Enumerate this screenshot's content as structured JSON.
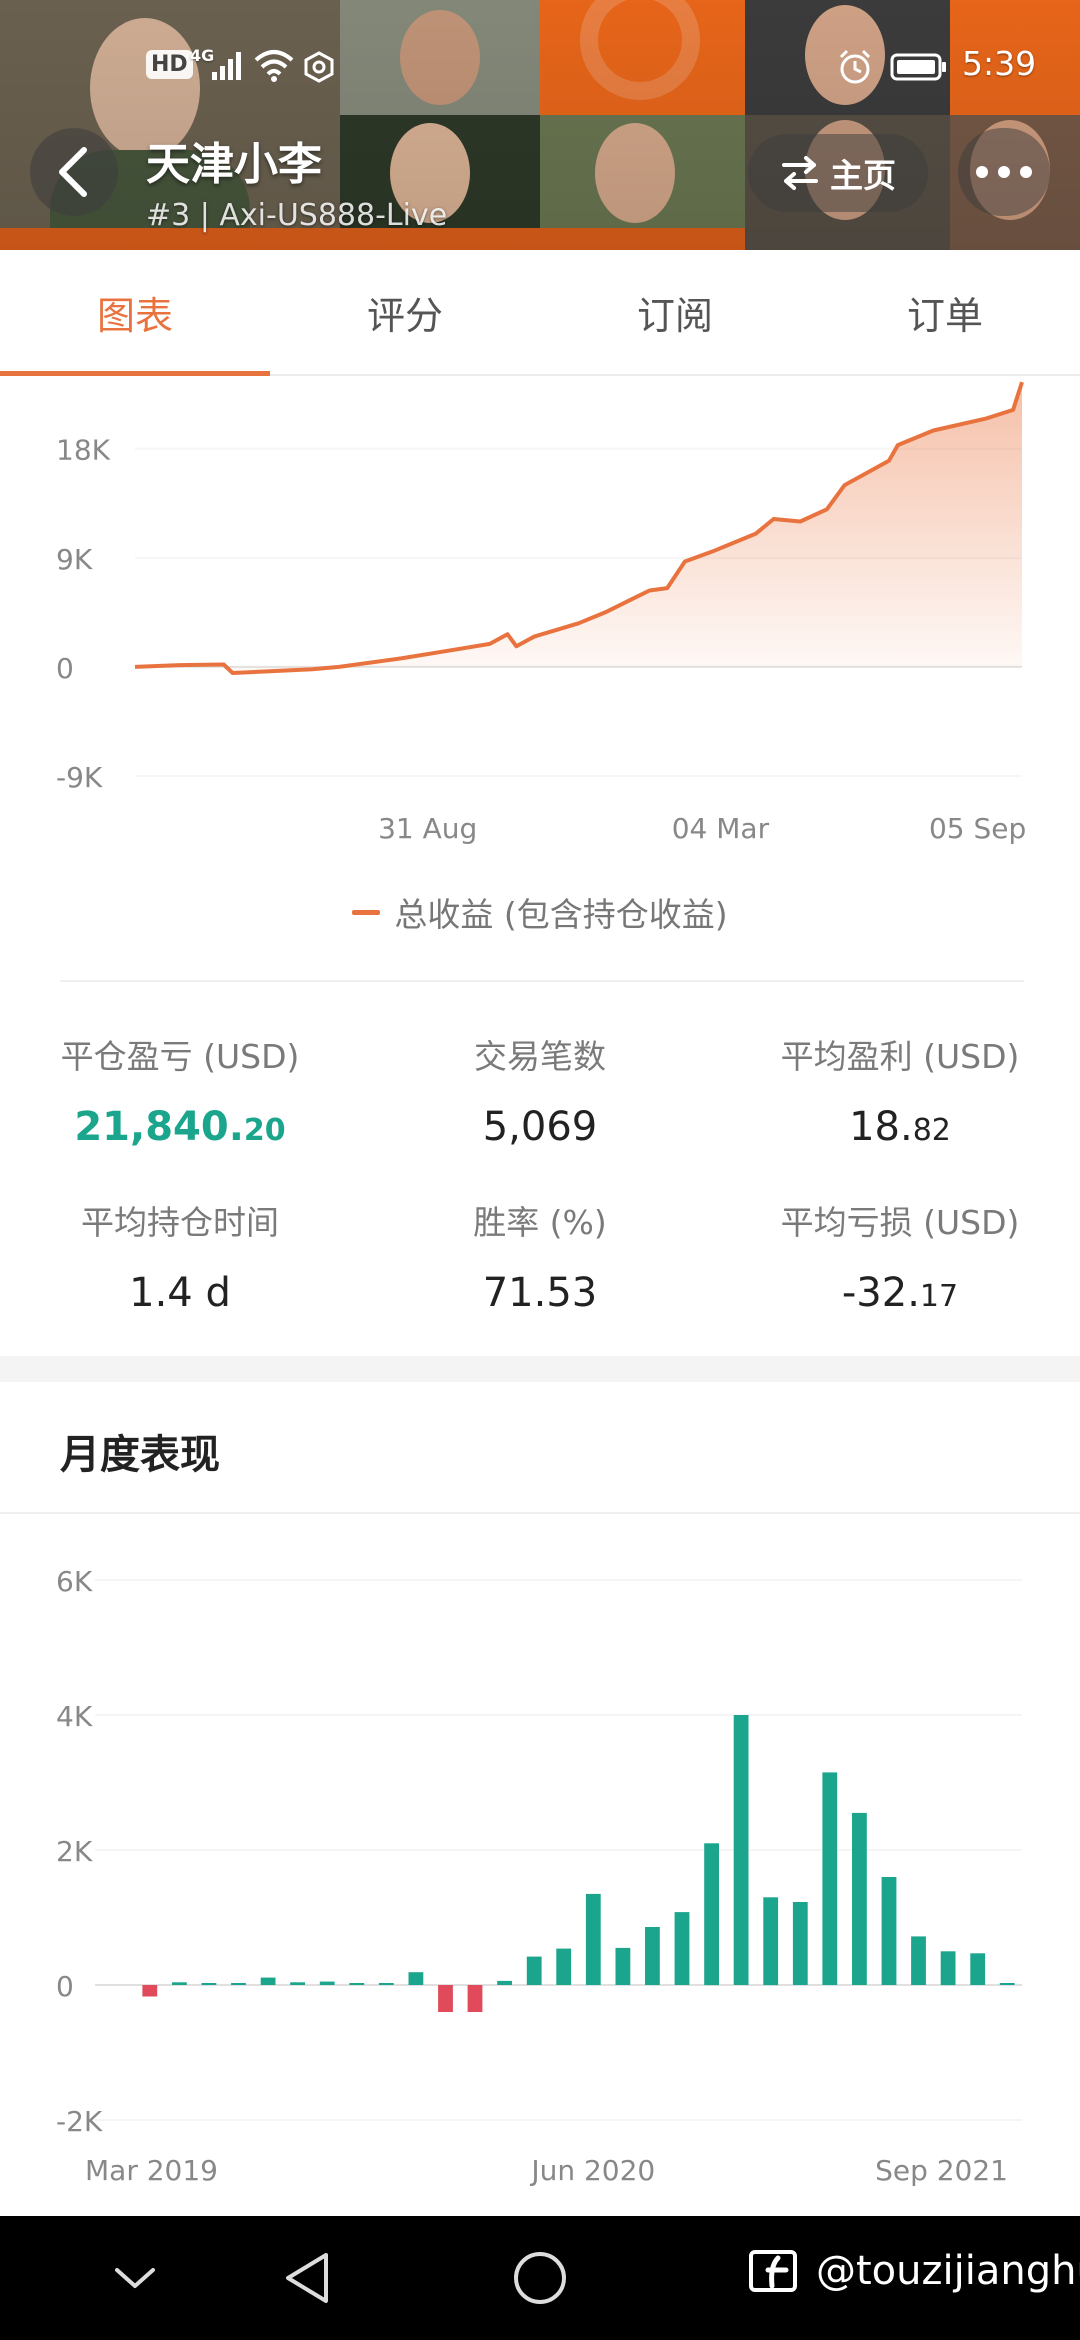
{
  "status_bar": {
    "hd": "HD",
    "network": "4G",
    "time": "5:39"
  },
  "header": {
    "trader_name": "天津小李",
    "trader_sub": "#3 | Axi-US888-Live",
    "homepage_label": "主页",
    "accent_color": "#f26a1b"
  },
  "tabs": [
    {
      "label": "图表",
      "active": true
    },
    {
      "label": "评分",
      "active": false
    },
    {
      "label": "订阅",
      "active": false
    },
    {
      "label": "订单",
      "active": false
    }
  ],
  "stats": [
    {
      "label": "平仓盈亏 (USD)",
      "value_int": "21,840.",
      "value_dec": "20",
      "highlight": true
    },
    {
      "label": "交易笔数",
      "value_int": "5,069",
      "value_dec": "",
      "highlight": false
    },
    {
      "label": "平均盈利 (USD)",
      "value_int": "18.",
      "value_dec": "82",
      "highlight": false
    },
    {
      "label": "平均持仓时间",
      "value_int": "1.4 d",
      "value_dec": "",
      "highlight": false
    },
    {
      "label": "胜率 (%)",
      "value_int": "71.53",
      "value_dec": "",
      "highlight": false
    },
    {
      "label": "平均亏损 (USD)",
      "value_int": "-32.",
      "value_dec": "17",
      "highlight": false
    }
  ],
  "monthly_title": "月度表现",
  "watermark": "@touzijianghu",
  "chart_data": [
    {
      "type": "area",
      "y_tick_labels": [
        "18K",
        "9K",
        "0",
        "-9K"
      ],
      "y_ticks": [
        18000,
        9000,
        0,
        -9000
      ],
      "ylim": [
        -9000,
        24000
      ],
      "x_tick_labels": [
        "31 Aug",
        "04 Mar",
        "05 Sep"
      ],
      "x_tick_positions": [
        0.33,
        0.66,
        0.95
      ],
      "legend": "总收益 (包含持仓收益)",
      "color": "#e9733e",
      "points": [
        [
          0.0,
          0
        ],
        [
          0.05,
          150
        ],
        [
          0.1,
          200
        ],
        [
          0.11,
          -500
        ],
        [
          0.2,
          -200
        ],
        [
          0.23,
          0
        ],
        [
          0.3,
          700
        ],
        [
          0.35,
          1300
        ],
        [
          0.4,
          1900
        ],
        [
          0.42,
          2700
        ],
        [
          0.43,
          1700
        ],
        [
          0.45,
          2500
        ],
        [
          0.5,
          3600
        ],
        [
          0.53,
          4500
        ],
        [
          0.58,
          6300
        ],
        [
          0.6,
          6500
        ],
        [
          0.62,
          8700
        ],
        [
          0.65,
          9500
        ],
        [
          0.7,
          11000
        ],
        [
          0.72,
          12200
        ],
        [
          0.75,
          12000
        ],
        [
          0.78,
          13000
        ],
        [
          0.8,
          15000
        ],
        [
          0.85,
          17000
        ],
        [
          0.86,
          18300
        ],
        [
          0.9,
          19500
        ],
        [
          0.96,
          20500
        ],
        [
          0.99,
          21200
        ],
        [
          1.0,
          23500
        ]
      ]
    },
    {
      "type": "bar",
      "y_tick_labels": [
        "6K",
        "4K",
        "2K",
        "0",
        "-2K"
      ],
      "y_ticks": [
        6000,
        4000,
        2000,
        0,
        -2000
      ],
      "ylim": [
        -2000,
        6000
      ],
      "x_tick_labels": [
        "Mar 2019",
        "Jun 2020",
        "Sep 2021"
      ],
      "x_tick_index": [
        0,
        15,
        28
      ],
      "positive_color": "#1aa58c",
      "negative_color": "#e04a5a",
      "values": [
        -170,
        40,
        10,
        10,
        110,
        40,
        50,
        20,
        10,
        190,
        -400,
        -400,
        60,
        420,
        540,
        1350,
        550,
        860,
        1080,
        2100,
        4000,
        1300,
        1230,
        3150,
        2550,
        1600,
        720,
        500,
        470,
        10
      ]
    }
  ]
}
